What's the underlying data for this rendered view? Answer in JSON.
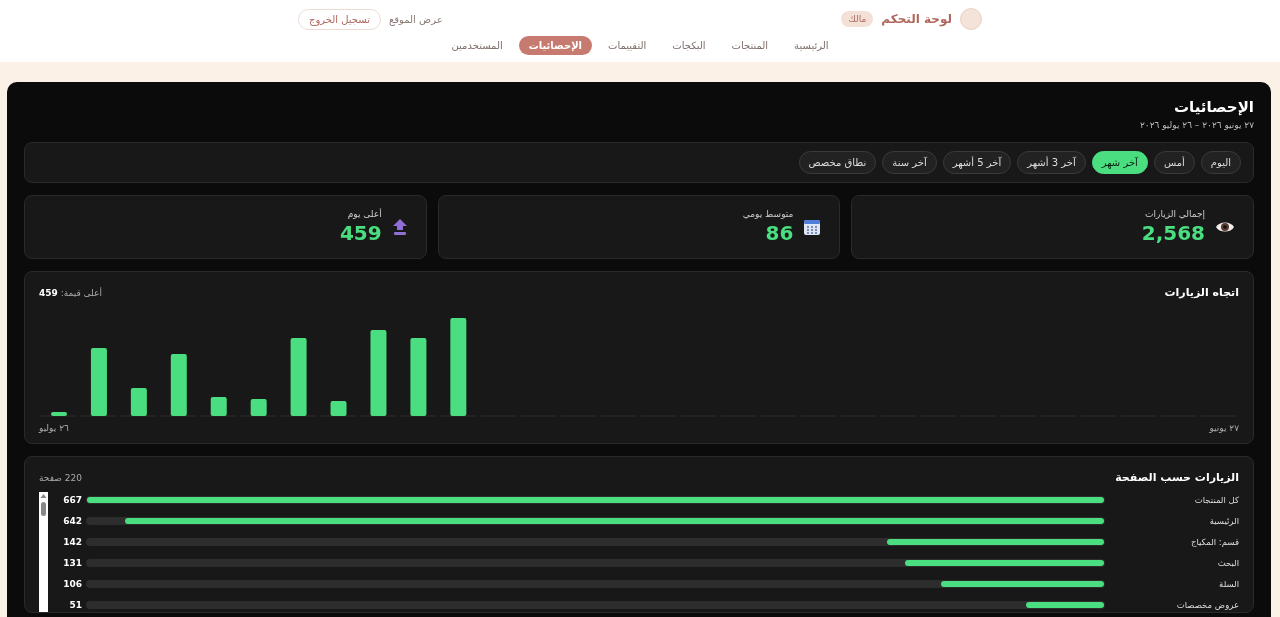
{
  "header": {
    "brand": "لوحة التحكم",
    "role_badge": "مالك",
    "view_site": "عرض الموقع",
    "logout": "تسجيل الخروج"
  },
  "nav": [
    {
      "label": "الرئيسية",
      "selected": false
    },
    {
      "label": "المنتجات",
      "selected": false
    },
    {
      "label": "البكجات",
      "selected": false
    },
    {
      "label": "التقييمات",
      "selected": false
    },
    {
      "label": "الإحصائيات",
      "selected": true
    },
    {
      "label": "المستخدمين",
      "selected": false
    }
  ],
  "page": {
    "title": "الإحصائيات",
    "date_range": "٢٧ يونيو ٢٠٢٦ – ٢٦ يوليو ٢٠٢٦"
  },
  "filters": [
    {
      "label": "اليوم",
      "selected": false
    },
    {
      "label": "أمس",
      "selected": false
    },
    {
      "label": "آخر شهر",
      "selected": true
    },
    {
      "label": "آخر 3 أشهر",
      "selected": false
    },
    {
      "label": "آخر 5 أشهر",
      "selected": false
    },
    {
      "label": "آخر سنة",
      "selected": false
    },
    {
      "label": "نطاق مخصص",
      "selected": false
    }
  ],
  "stats": [
    {
      "kind": "eye",
      "label": "إجمالي الزيارات",
      "value": "2,568"
    },
    {
      "kind": "calendar",
      "label": "متوسط يومي",
      "value": "86"
    },
    {
      "kind": "top",
      "label": "أعلى يوم",
      "value": "459"
    }
  ],
  "trend": {
    "title": "اتجاه الزيارات",
    "max_label": "أعلى قيمة:",
    "max_value": "459",
    "start_label": "٢٧ يونيو",
    "end_label": "٢٦ يوليو"
  },
  "pages": {
    "title": "الزيارات حسب الصفحة",
    "count": "220 صفحة",
    "rows": [
      {
        "name": "كل المنتجات",
        "value": "667",
        "level": 1.0
      },
      {
        "name": "الرئيسية",
        "value": "642",
        "level": 0.963
      },
      {
        "name": "قسم: المكياج",
        "value": "142",
        "level": 0.213
      },
      {
        "name": "البحث",
        "value": "131",
        "level": 0.196
      },
      {
        "name": "السلة",
        "value": "106",
        "level": 0.16
      },
      {
        "name": "عروض مخصصات",
        "value": "51",
        "level": 0.077
      }
    ]
  }
}
